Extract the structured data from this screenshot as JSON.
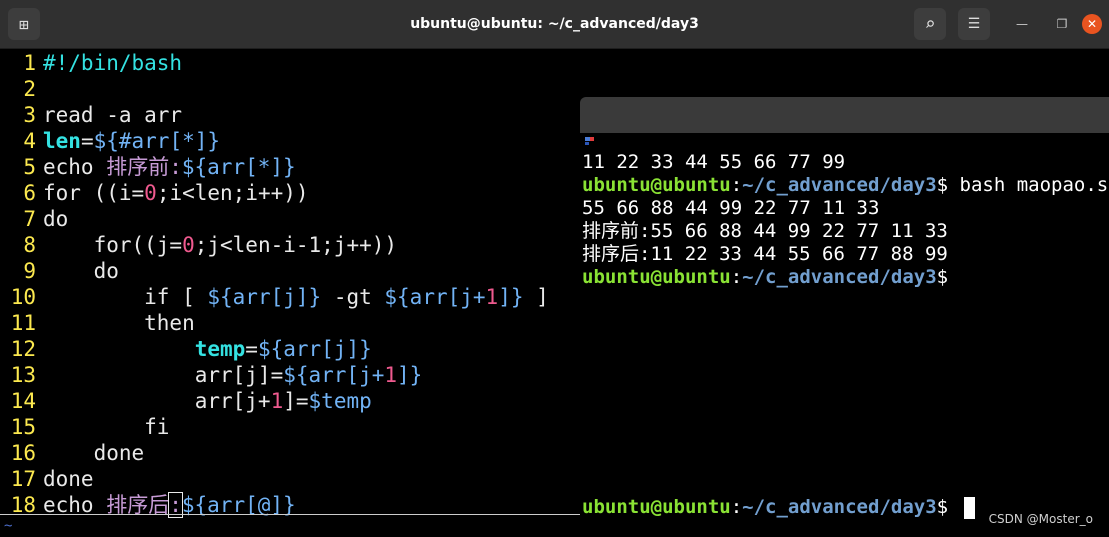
{
  "window": {
    "title": "ubuntu@ubuntu: ~/c_advanced/day3",
    "min_glyph": "—",
    "max_glyph": "❐",
    "close_glyph": "✕",
    "newtab_glyph": "⊞",
    "search_glyph": "⌕",
    "menu_glyph": "☰"
  },
  "editor": {
    "line_numbers": [
      "1",
      "2",
      "3",
      "4",
      "5",
      "6",
      "7",
      "8",
      "9",
      "10",
      "11",
      "12",
      "13",
      "14",
      "15",
      "16",
      "17",
      "18"
    ],
    "tilde": "~"
  },
  "terminal": {
    "line1": "11 22 33 44 55 66 77 99",
    "prompt_user": "ubuntu@ubuntu",
    "prompt_sep": ":",
    "prompt_path": "~/c_advanced/day3",
    "prompt_end": "$ ",
    "command": "bash maopao.sh",
    "input_line": "55 66 88 44 99 22 77 11 33",
    "before_label": "排序前:",
    "before_values": "55 66 88 44 99 22 77 11 33",
    "after_label": "排序后:",
    "after_values": "11 22 33 44 55 66 77 88 99"
  },
  "watermark": "CSDN @Moster_o"
}
